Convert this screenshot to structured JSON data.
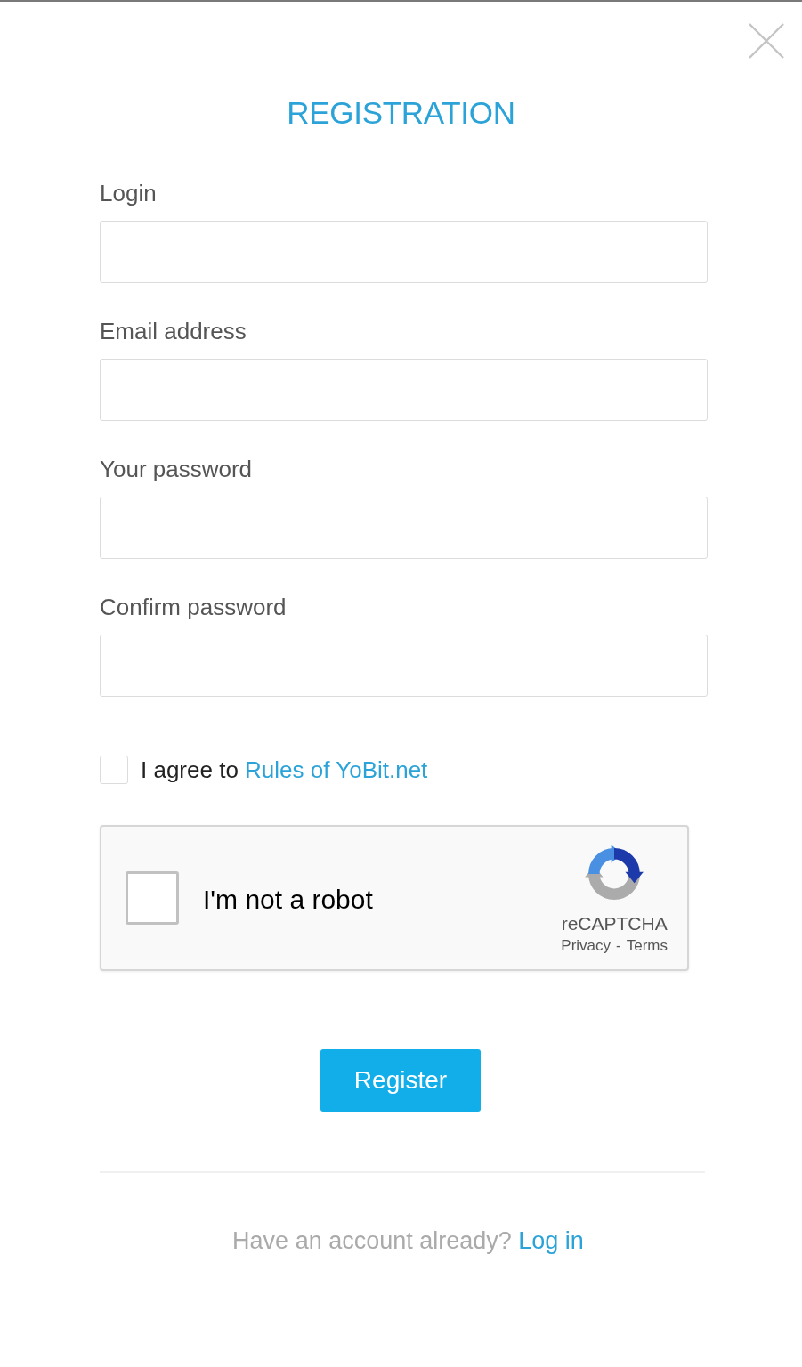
{
  "title": "REGISTRATION",
  "fields": [
    {
      "label": "Login"
    },
    {
      "label": "Email address"
    },
    {
      "label": "Your password"
    },
    {
      "label": "Confirm password"
    }
  ],
  "agreement": {
    "checked": false,
    "text": "I agree to",
    "link": "Rules of YoBit.net"
  },
  "captcha": {
    "checked": false,
    "label": "I'm not a robot",
    "brand": "reCAPTCHA",
    "links": [
      "Privacy",
      "Terms"
    ],
    "separator": "-"
  },
  "submit": {
    "label": "Register"
  },
  "footer": {
    "text": "Have an account already?",
    "link": "Log in"
  }
}
